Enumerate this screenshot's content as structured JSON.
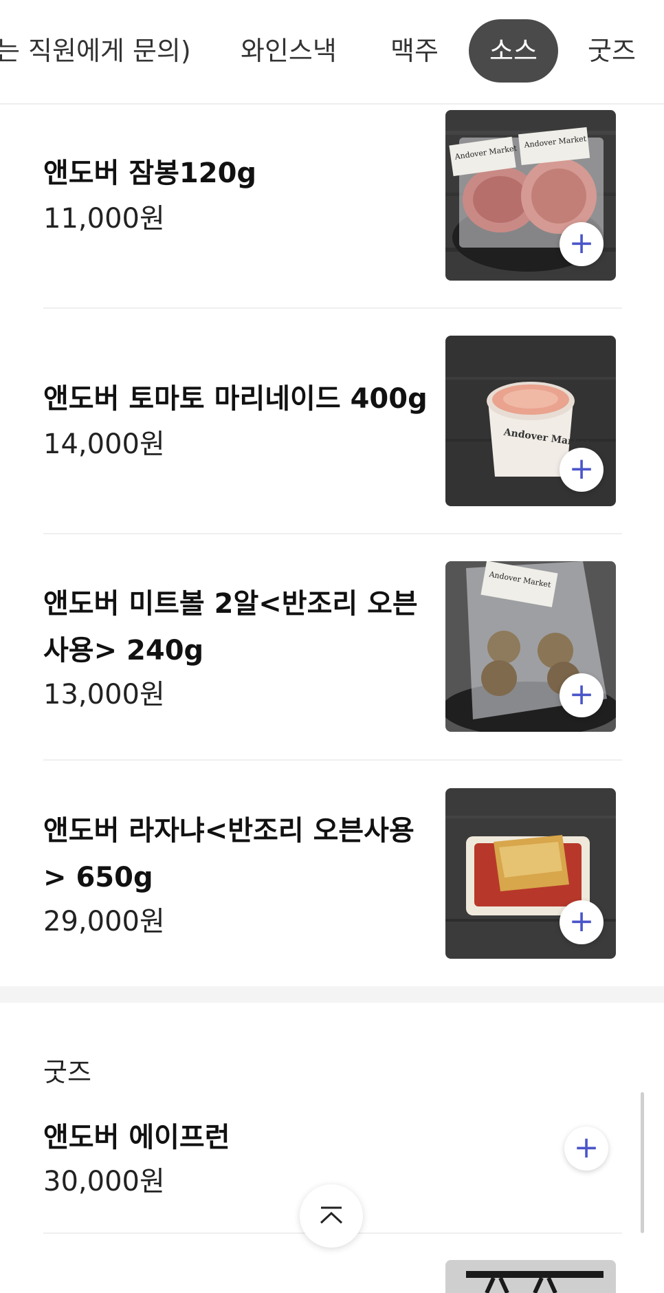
{
  "tabs": [
    {
      "label": "는 직원에게 문의)"
    },
    {
      "label": "와인스낵"
    },
    {
      "label": "맥주"
    },
    {
      "label": "소스",
      "active": true
    },
    {
      "label": "굿즈"
    }
  ],
  "products": [
    {
      "name": "앤도버 잠봉120g",
      "price": "11,000원",
      "image": "sliced-ham-photo",
      "label_text": "Andover Market"
    },
    {
      "name": "앤도버 토마토 마리네이드 400g",
      "price": "14,000원",
      "image": "tomato-marinade-tub-photo",
      "label_text": "Andover Market"
    },
    {
      "name": "앤도버 미트볼 2알<반조리 오븐사용> 240g",
      "name_line1": "앤도버 미트볼 2알<반조리 오븐",
      "name_line2": "사용> 240g",
      "price": "13,000원",
      "image": "meatball-pack-photo",
      "label_text": "Andover Market"
    },
    {
      "name": "앤도버 라자냐<반조리 오븐사용> 650g",
      "name_line1": "앤도버 라자냐<반조리 오븐사용",
      "name_line2": "> 650g",
      "price": "29,000원",
      "image": "lasagna-dish-photo"
    }
  ],
  "goods_section": {
    "title": "굿즈",
    "items": [
      {
        "name": "앤도버 에이프런",
        "price": "30,000원"
      }
    ]
  },
  "icons": {
    "add": "plus-icon",
    "top": "chevron-up-icon"
  },
  "colors": {
    "accent": "#4a55c9",
    "active_tab_bg": "#4a4a4a"
  }
}
